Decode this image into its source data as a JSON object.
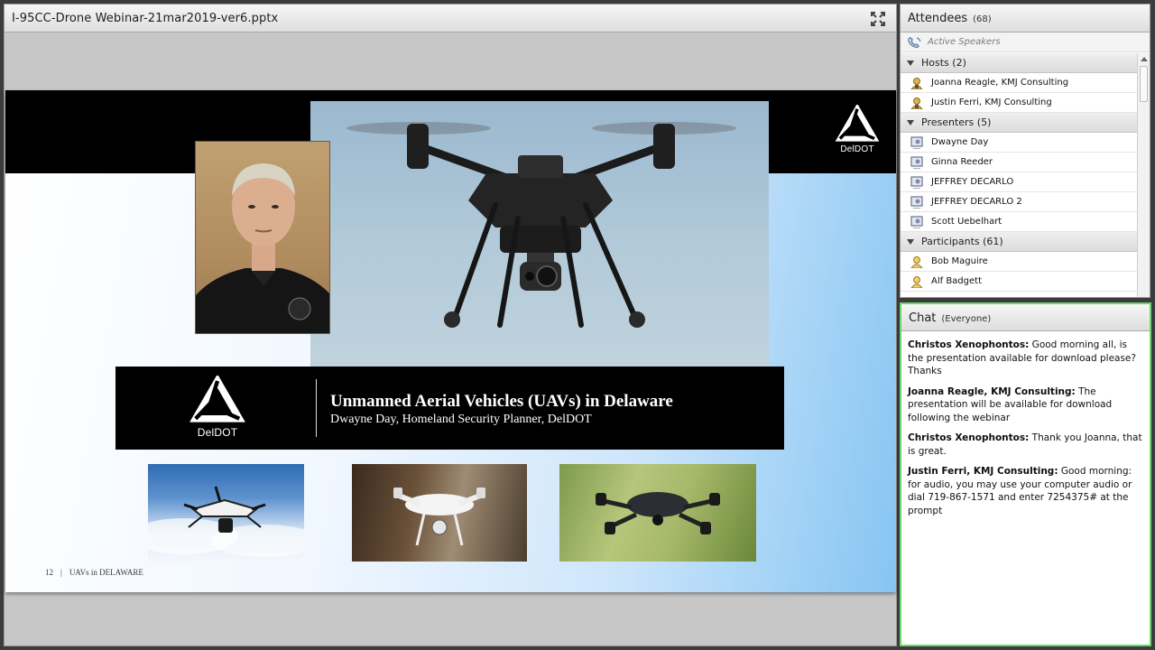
{
  "share": {
    "title": "I-95CC-Drone Webinar-21mar2019-ver6.pptx"
  },
  "slide": {
    "logo_text": "DelDOT",
    "banner_title": "Unmanned Aerial Vehicles (UAVs) in Delaware",
    "banner_subtitle": "Dwayne Day, Homeland Security Planner, DelDOT",
    "footer_page": "12",
    "footer_sep": "|",
    "footer_text": "UAVs in DELAWARE"
  },
  "attendees": {
    "title": "Attendees",
    "count": "(68)",
    "active_speakers": "Active Speakers",
    "groups": [
      {
        "label": "Hosts (2)",
        "people": [
          "Joanna Reagle, KMJ Consulting",
          "Justin Ferri, KMJ Consulting"
        ]
      },
      {
        "label": "Presenters (5)",
        "people": [
          "Dwayne Day",
          "Ginna Reeder",
          "JEFFREY DECARLO",
          "JEFFREY DECARLO 2",
          "Scott Uebelhart"
        ]
      },
      {
        "label": "Participants (61)",
        "people": [
          "Bob  Maguire",
          "Alf Badgett"
        ]
      }
    ]
  },
  "chat": {
    "title": "Chat",
    "scope": "(Everyone)",
    "messages": [
      {
        "sender": "Christos Xenophontos:",
        "text": " Good morning all, is the presentation available for download please? Thanks"
      },
      {
        "sender": "Joanna Reagle, KMJ Consulting:",
        "text": " The presentation will be available for download following the webinar"
      },
      {
        "sender": "Christos Xenophontos:",
        "text": " Thank you Joanna, that is great."
      },
      {
        "sender": "Justin Ferri, KMJ Consulting:",
        "text": " Good morning: for audio, you may use your computer audio or dial 719-867-1571 and enter 7254375# at the prompt"
      }
    ]
  },
  "colors": {
    "chat_border": "#6fd36f",
    "slide_band": "#000000"
  }
}
